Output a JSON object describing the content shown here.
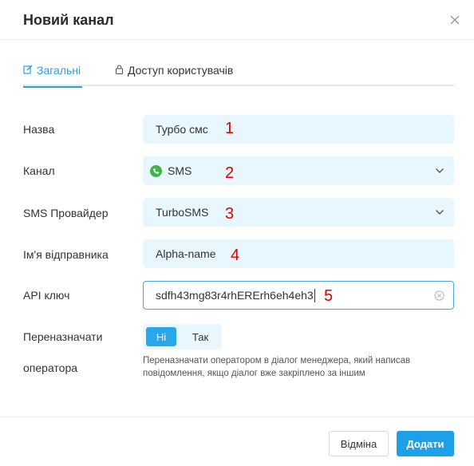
{
  "dialog": {
    "title": "Новий канал",
    "close_icon": "close-icon"
  },
  "tabs": [
    {
      "label": "Загальні",
      "icon": "edit-icon",
      "active": true
    },
    {
      "label": "Доступ користувачів",
      "icon": "lock-icon",
      "active": false
    }
  ],
  "form": {
    "name": {
      "label": "Назва",
      "value": "Турбо смс",
      "annotation": "1"
    },
    "channel": {
      "label": "Канал",
      "value": "SMS",
      "icon": "phone-icon",
      "annotation": "2"
    },
    "provider": {
      "label": "SMS Провайдер",
      "value": "TurboSMS",
      "annotation": "3"
    },
    "sender": {
      "label": "Ім'я відправника",
      "value": "Alpha-name",
      "annotation": "4"
    },
    "api_key": {
      "label": "API ключ",
      "value": "sdfh43mg83r4rhERErh6eh4eh3",
      "annotation": "5"
    },
    "reassign": {
      "label_line1": "Переназначати",
      "label_line2": "оператора",
      "option_no": "Ні",
      "option_yes": "Так",
      "selected": "Ні",
      "hint": "Переназначати оператором в діалог менеджера, який написав повідомлення, якщо діалог вже закріплено за іншим"
    }
  },
  "footer": {
    "cancel_label": "Відміна",
    "add_label": "Додати"
  },
  "colors": {
    "accent": "#1ea0e8",
    "field_bg": "#e8f6fd",
    "annotation": "#e00000"
  }
}
